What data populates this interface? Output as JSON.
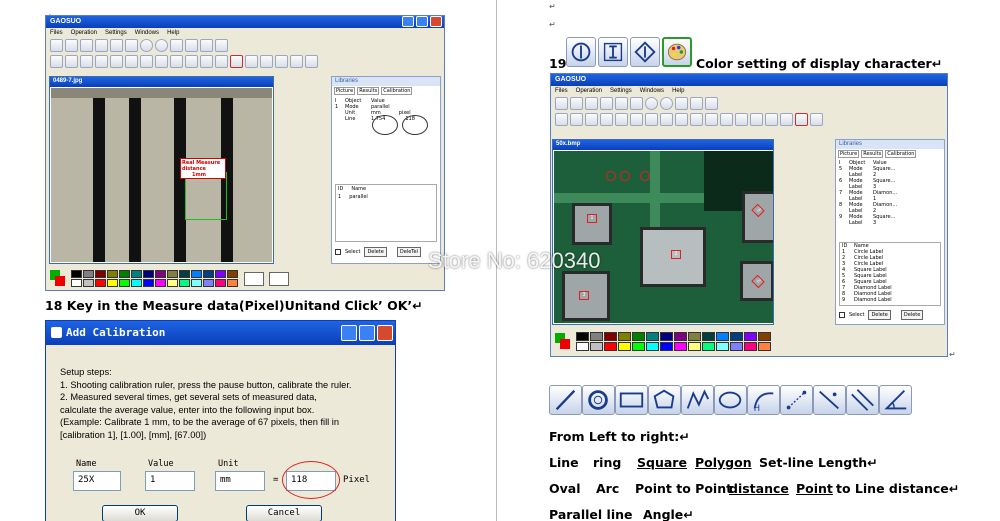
{
  "left_app": {
    "title": "GAOSUO",
    "menus": [
      "Files",
      "Operation",
      "Settings",
      "Windows",
      "Help"
    ],
    "image_window_title": "0489-7.jpg",
    "annotation_lines": [
      "Real Measure",
      "distance",
      "1mm"
    ],
    "libraries_title": "Libraries",
    "tabs": [
      "Picture",
      "Results",
      "Calibration"
    ],
    "results_header": [
      "I",
      "Object",
      "Value"
    ],
    "results_rows": [
      [
        "1",
        "Mode",
        "parallel"
      ],
      [
        "",
        "Unit",
        "mm"
      ],
      [
        "",
        "Line",
        "1.754"
      ]
    ],
    "unit_pixel_label": "pixel",
    "unit_pixel_value": "118",
    "list_header": [
      "ID",
      "Name"
    ],
    "list_rows": [
      [
        "1",
        "parallel"
      ]
    ],
    "select_label": "Select",
    "delete_label": "Delete",
    "delete2_label": "DeleTel"
  },
  "step18": {
    "heading": "18 Key in the Measure data(Pixel)Unitand Click’ OK’↵"
  },
  "dialog": {
    "title": "Add Calibration",
    "setup_lines": [
      "Setup steps:",
      "1. Shooting calibration ruler, press the pause button, calibrate the ruler.",
      "2. Measured several times, get several sets of measured data,",
      "calculate the average value, enter into the following input box.",
      "(Example: Calibrate 1 mm, to be the average of 67 pixels, then fill in",
      "[calibration 1], [1.00], [mm], [67.00])"
    ],
    "name_label": "Name",
    "value_label": "Value",
    "unit_label": "Unit",
    "name_value": "25X",
    "value_value": "1",
    "unit_value": "mm",
    "equals": "=",
    "pixel_value": "118",
    "pixel_label": "Pixel",
    "ok_label": "OK",
    "cancel_label": "Cancel"
  },
  "step19": {
    "number": "19",
    "heading": "Color setting of display character↵",
    "icons": [
      "circle-bar-icon",
      "text-cursor-icon",
      "diamond-icon",
      "palette-icon"
    ]
  },
  "right_app": {
    "title": "GAOSUO",
    "menus": [
      "Files",
      "Operation",
      "Settings",
      "Windows",
      "Help"
    ],
    "image_window_title": "50x.bmp",
    "libraries_title": "Libraries",
    "tabs": [
      "Picture",
      "Results",
      "Calibration"
    ],
    "results_header": [
      "I",
      "Object",
      "Value"
    ],
    "results_rows": [
      [
        "5",
        "Mode",
        "Square..."
      ],
      [
        "",
        "Label",
        "2"
      ],
      [
        "6",
        "Mode",
        "Square..."
      ],
      [
        "",
        "Label",
        "3"
      ],
      [
        "7",
        "Mode",
        "Diamon..."
      ],
      [
        "",
        "Label",
        "1"
      ],
      [
        "8",
        "Mode",
        "Diamon..."
      ],
      [
        "",
        "Label",
        "2"
      ],
      [
        "9",
        "Mode",
        "Square..."
      ],
      [
        "",
        "Label",
        "3"
      ]
    ],
    "list_header": [
      "ID",
      "Name"
    ],
    "list_rows": [
      [
        "1",
        "Circle Label"
      ],
      [
        "2",
        "Circle Label"
      ],
      [
        "3",
        "Circle Label"
      ],
      [
        "4",
        "Square Label"
      ],
      [
        "5",
        "Square Label"
      ],
      [
        "6",
        "Square Label"
      ],
      [
        "7",
        "Diamond Label"
      ],
      [
        "8",
        "Diamond Label"
      ],
      [
        "9",
        "Diamond Label"
      ]
    ],
    "select_label": "Select",
    "delete_label": "Delete",
    "delete2_label": "Delete",
    "pcb_labels": [
      "1",
      "2",
      "3",
      "2",
      "3"
    ]
  },
  "watermark": "Store No: 620340",
  "tools_row": {
    "icons": [
      "line-icon",
      "ring-icon",
      "square-icon",
      "polygon-icon",
      "set-line-icon",
      "oval-icon",
      "arc-icon",
      "point-to-point-icon",
      "point-to-line-icon",
      "parallel-line-icon",
      "angle-icon"
    ]
  },
  "legend": {
    "intro": "From Left to right:↵",
    "line1": [
      "Line",
      "ring",
      "Square",
      "Polygon",
      "Set-line Length↵"
    ],
    "line2": [
      "Oval",
      "Arc",
      "Point to Point",
      "distance",
      "Point",
      "to Line distance↵"
    ],
    "line3": [
      "Parallel line",
      "Angle↵"
    ]
  },
  "colors": {
    "xp_blue": "#0a3fb8",
    "annotation_red": "#d60000",
    "pcb_green": "#1d5f3a"
  },
  "palette": [
    "#000000",
    "#808080",
    "#800000",
    "#808000",
    "#008000",
    "#008080",
    "#000080",
    "#800080",
    "#808040",
    "#004040",
    "#0080ff",
    "#004080",
    "#8000ff",
    "#804000",
    "#ffffff",
    "#c0c0c0",
    "#ff0000",
    "#ffff00",
    "#00ff00",
    "#00ffff",
    "#0000ff",
    "#ff00ff",
    "#ffff80",
    "#00ff80",
    "#80ffff",
    "#8080ff",
    "#ff0080",
    "#ff8040"
  ]
}
